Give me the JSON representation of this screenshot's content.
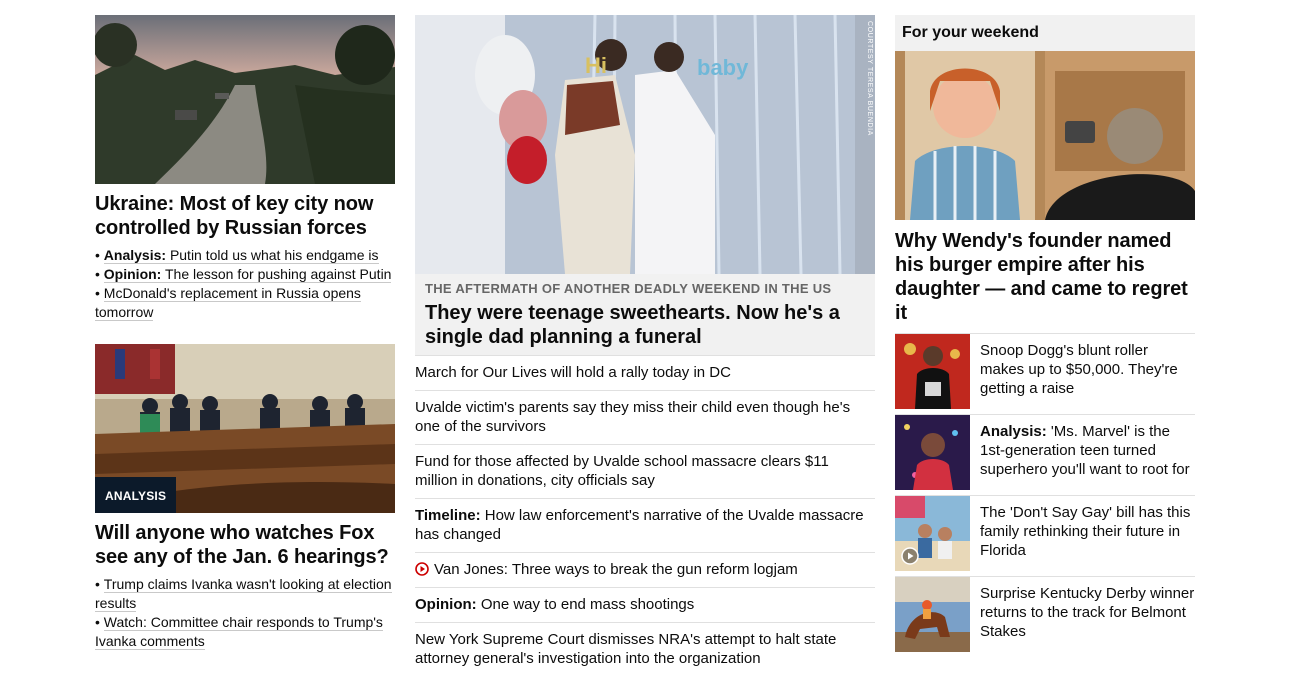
{
  "left": {
    "story1": {
      "headline": "Ukraine: Most of key city now controlled by Russian forces",
      "bullets": [
        {
          "prefix": "Analysis:",
          "text": "Putin told us what his endgame is"
        },
        {
          "prefix": "Opinion:",
          "text": "The lesson for pushing against Putin"
        },
        {
          "prefix": "",
          "text": "McDonald's replacement in Russia opens tomorrow"
        }
      ]
    },
    "story2": {
      "badge": "ANALYSIS",
      "headline": "Will anyone who watches Fox see any of the Jan. 6 hearings?",
      "bullets": [
        {
          "prefix": "",
          "text": "Trump claims Ivanka wasn't looking at election results"
        },
        {
          "prefix": "",
          "text": "Watch: Committee chair responds to Trump's Ivanka comments"
        }
      ]
    }
  },
  "middle": {
    "photo_credit": "COURTESY TERESA BUENDIA",
    "kicker": "THE AFTERMATH OF ANOTHER DEADLY WEEKEND IN THE US",
    "headline": "They were teenage sweethearts. Now he's a single dad planning a funeral",
    "items": [
      {
        "prefix": "",
        "text": "March for Our Lives will hold a rally today in DC",
        "video": false
      },
      {
        "prefix": "",
        "text": "Uvalde victim's parents say they miss their child even though he's one of the survivors",
        "video": false
      },
      {
        "prefix": "",
        "text": "Fund for those affected by Uvalde school massacre clears $11 million in donations, city officials say",
        "video": false
      },
      {
        "prefix": "Timeline:",
        "text": "How law enforcement's narrative of the Uvalde massacre has changed",
        "video": false
      },
      {
        "prefix": "",
        "text": "Van Jones: Three ways to break the gun reform logjam",
        "video": true
      },
      {
        "prefix": "Opinion:",
        "text": "One way to end mass shootings",
        "video": false
      },
      {
        "prefix": "",
        "text": "New York Supreme Court dismisses NRA's attempt to halt state attorney general's investigation into the organization",
        "video": false
      }
    ]
  },
  "right": {
    "section_title": "For your weekend",
    "headline": "Why Wendy's founder named his burger empire after his daughter — and came to regret it",
    "items": [
      {
        "prefix": "",
        "text": "Snoop Dogg's blunt roller makes up to $50,000. They're getting a raise"
      },
      {
        "prefix": "Analysis:",
        "text": "'Ms. Marvel' is the 1st-generation teen turned superhero you'll want to root for"
      },
      {
        "prefix": "",
        "text": "The 'Don't Say Gay' bill has this family rethinking their future in Florida"
      },
      {
        "prefix": "",
        "text": "Surprise Kentucky Derby winner returns to the track for Belmont Stakes"
      }
    ]
  },
  "colors": {
    "video_red": "#cc0000",
    "badge_bg": "#0c1a2a",
    "divider": "#e0e0e0"
  }
}
